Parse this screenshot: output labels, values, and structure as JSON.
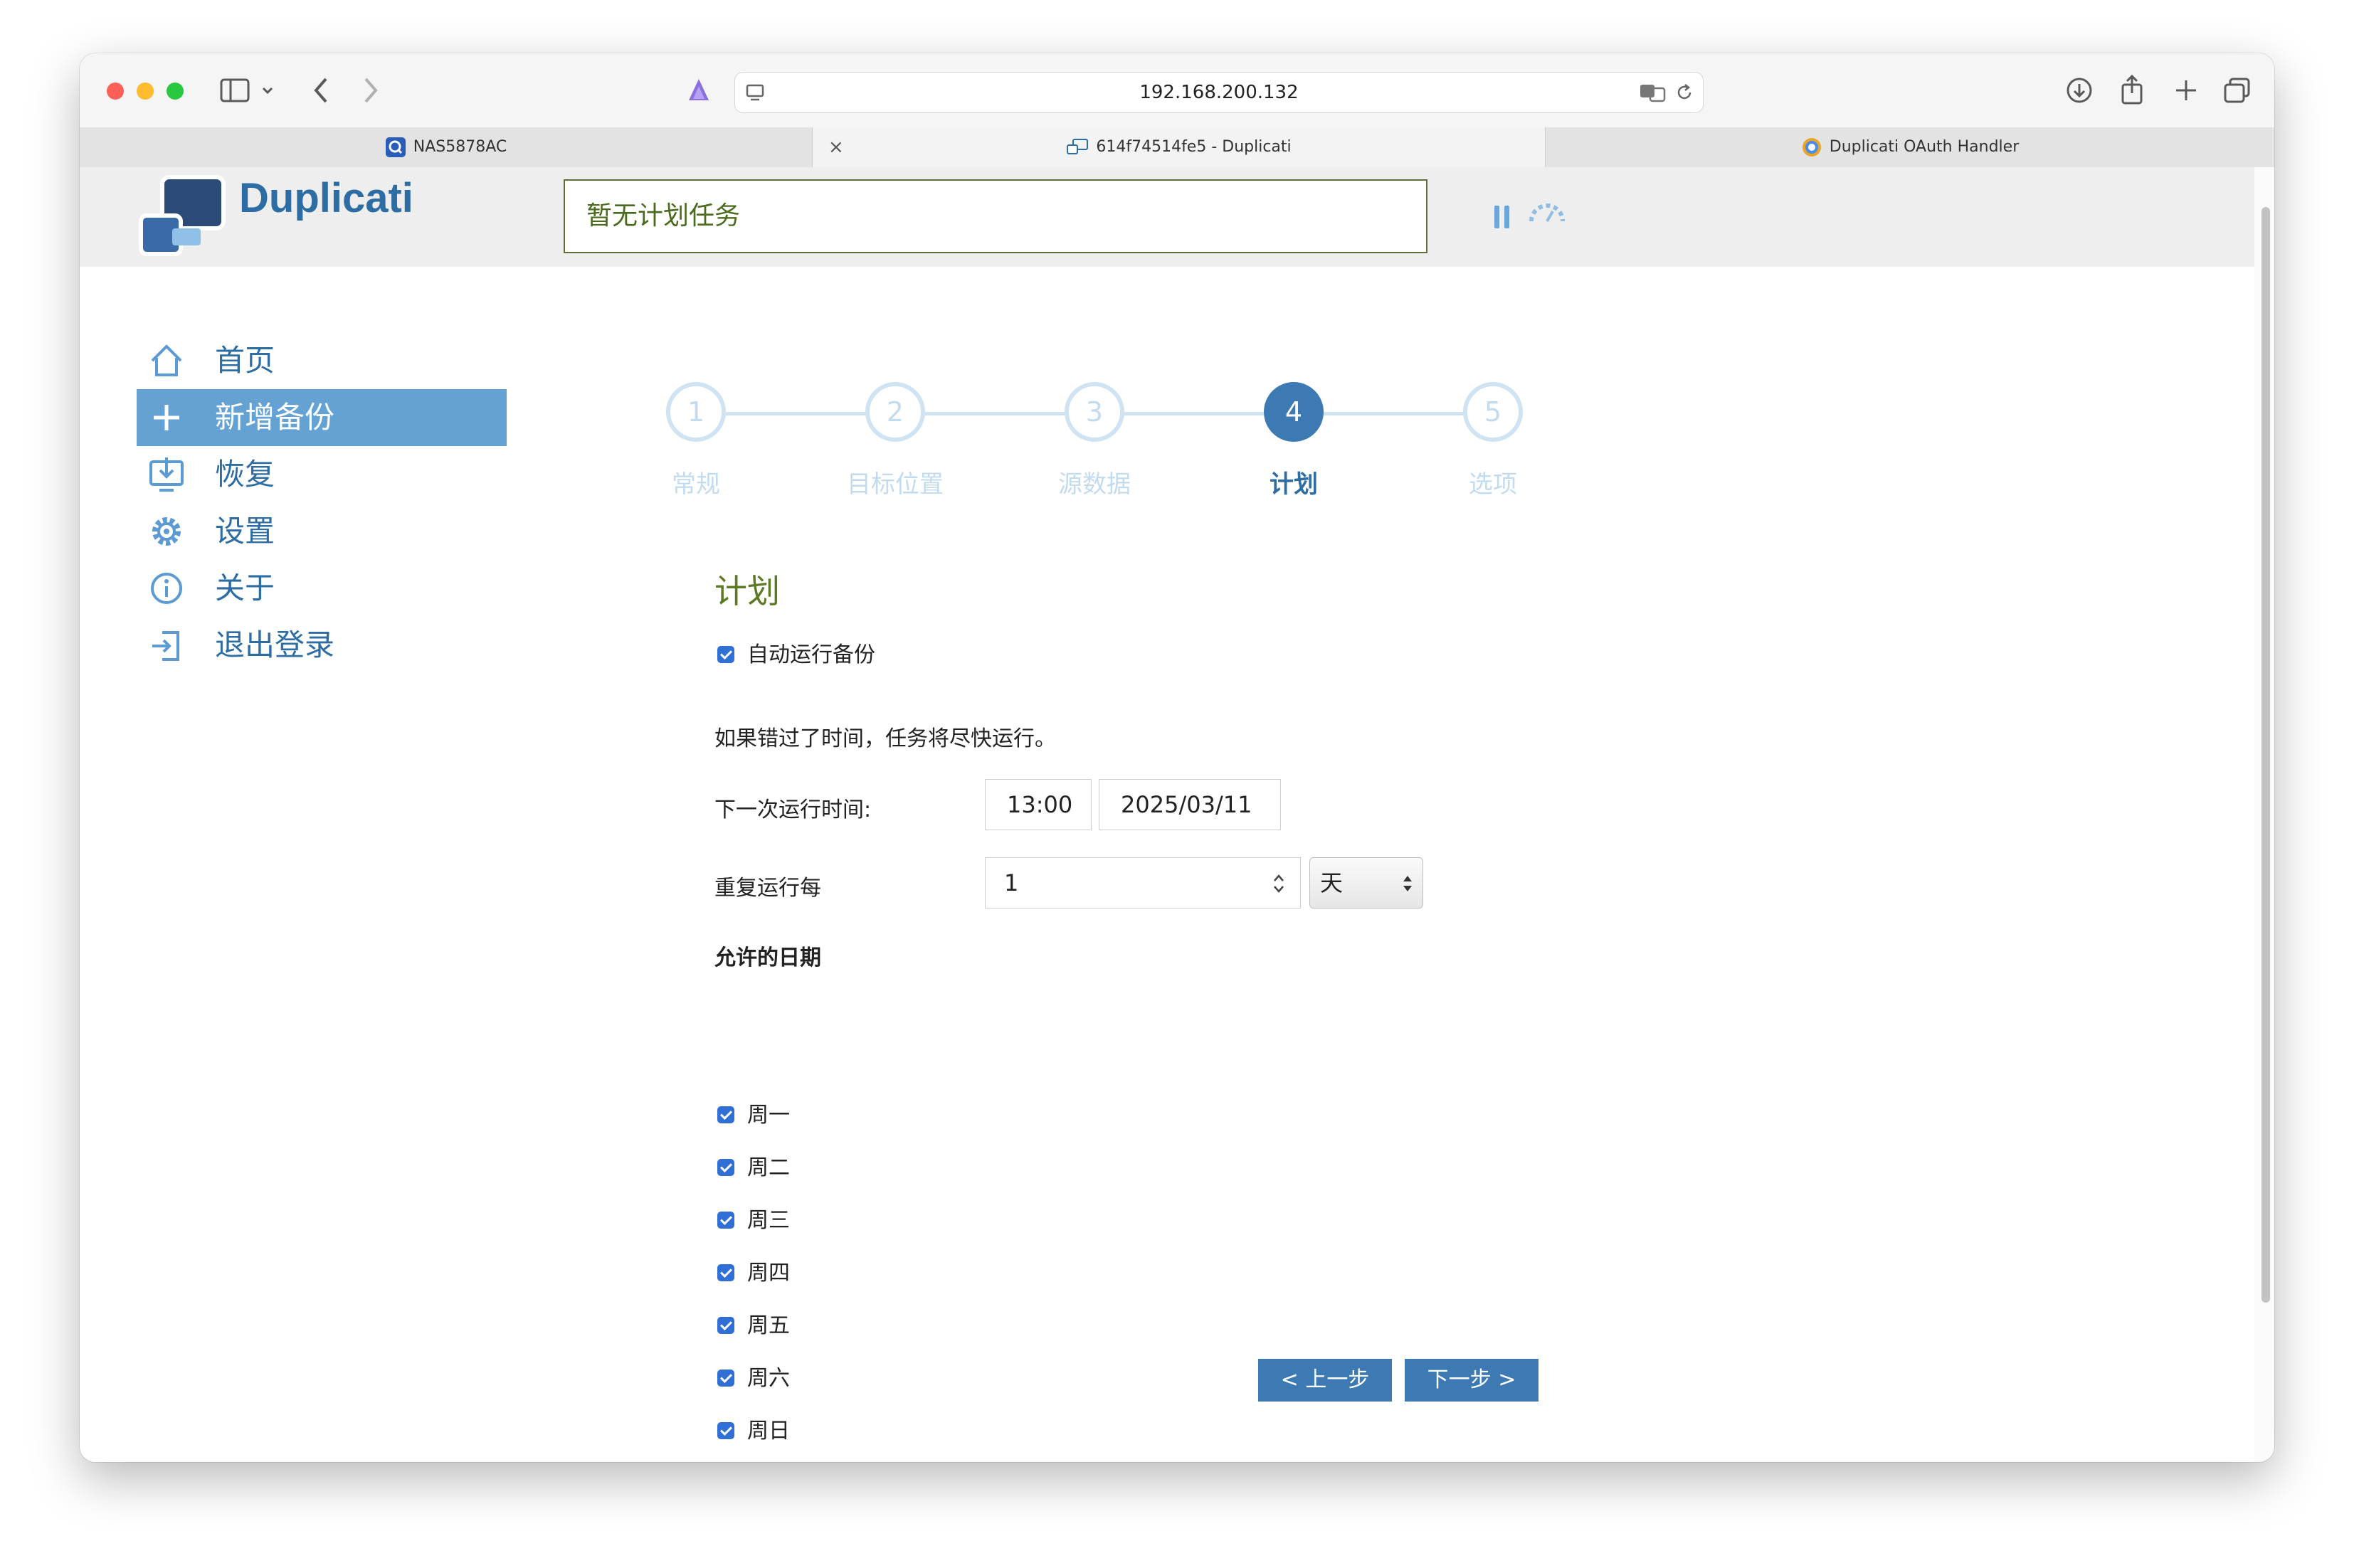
{
  "browser": {
    "url": "192.168.200.132",
    "tabs": [
      {
        "label": "NAS5878AC"
      },
      {
        "label": "614f74514fe5 - Duplicati"
      },
      {
        "label": "Duplicati OAuth Handler"
      }
    ],
    "close_symbol": "×"
  },
  "app": {
    "name": "Duplicati",
    "status_text": "暂无计划任务",
    "brand_color": "#2e6da4"
  },
  "sidebar": {
    "items": [
      {
        "label": "首页",
        "icon": "home-icon"
      },
      {
        "label": "新增备份",
        "icon": "plus-icon"
      },
      {
        "label": "恢复",
        "icon": "restore-icon"
      },
      {
        "label": "设置",
        "icon": "gear-icon"
      },
      {
        "label": "关于",
        "icon": "info-icon"
      },
      {
        "label": "退出登录",
        "icon": "logout-icon"
      }
    ]
  },
  "steps": [
    {
      "number": "1",
      "label": "常规"
    },
    {
      "number": "2",
      "label": "目标位置"
    },
    {
      "number": "3",
      "label": "源数据"
    },
    {
      "number": "4",
      "label": "计划"
    },
    {
      "number": "5",
      "label": "选项"
    }
  ],
  "active_step": 4,
  "schedule": {
    "title": "计划",
    "auto_run_label": "自动运行备份",
    "missed_note": "如果错过了时间，任务将尽快运行。",
    "next_run_label": "下一次运行时间:",
    "next_run_time": "13:00",
    "next_run_date": "2025/03/11",
    "repeat_label": "重复运行每",
    "repeat_value": "1",
    "repeat_unit": "天",
    "allowed_days_label": "允许的日期",
    "days": [
      "周一",
      "周二",
      "周三",
      "周四",
      "周五",
      "周六",
      "周日"
    ]
  },
  "buttons": {
    "prev": "< 上一步",
    "next": "下一步 >"
  }
}
